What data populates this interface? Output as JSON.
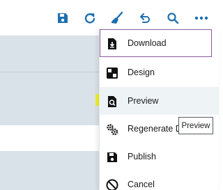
{
  "toolbar": {
    "save_icon": "save-icon",
    "refresh_icon": "refresh-icon",
    "clean_icon": "broom-icon",
    "undo_icon": "undo-icon",
    "search_icon": "search-icon",
    "more_icon": "more-horizontal-icon"
  },
  "colors": {
    "accent": "#1e6fb0",
    "highlight": "#f2f20a",
    "focus_border": "#8a5a9b",
    "panel_bg": "#d9e2e8"
  },
  "menu": {
    "items": [
      {
        "label": "Download",
        "icon": "download-file-icon"
      },
      {
        "label": "Design",
        "icon": "design-icon"
      },
      {
        "label": "Preview",
        "icon": "preview-icon"
      },
      {
        "label": "Regenerate Da",
        "icon": "gears-icon"
      },
      {
        "label": "Publish",
        "icon": "publish-icon"
      },
      {
        "label": "Cancel",
        "icon": "cancel-icon"
      }
    ]
  },
  "tooltip": {
    "text": "Preview"
  }
}
